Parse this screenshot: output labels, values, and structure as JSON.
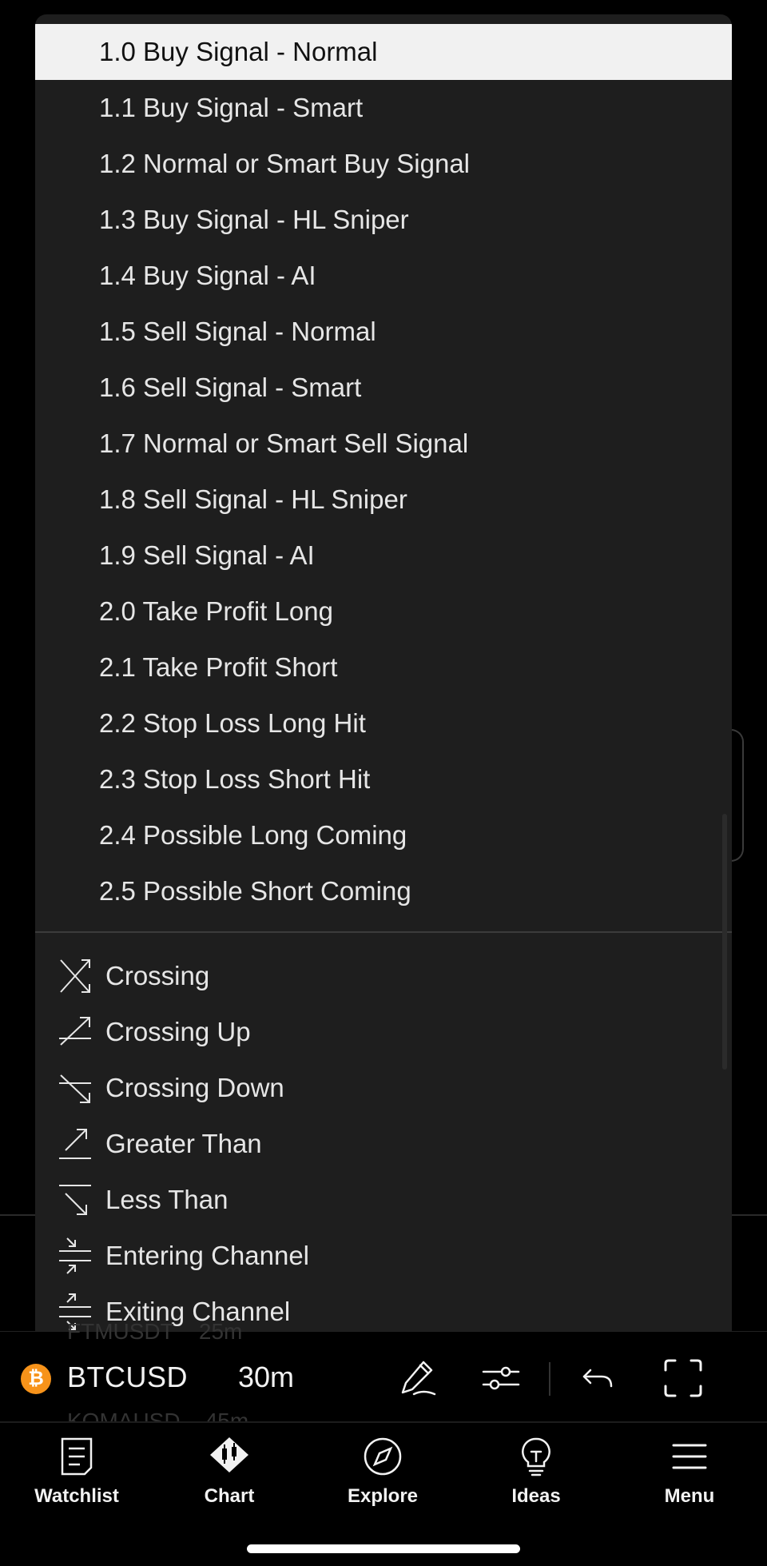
{
  "signals": [
    {
      "label": "1.0 Buy Signal - Normal",
      "selected": true
    },
    {
      "label": "1.1 Buy Signal - Smart"
    },
    {
      "label": "1.2 Normal or Smart Buy Signal"
    },
    {
      "label": "1.3 Buy Signal - HL Sniper"
    },
    {
      "label": "1.4 Buy Signal - AI"
    },
    {
      "label": "1.5 Sell Signal - Normal"
    },
    {
      "label": "1.6 Sell Signal - Smart"
    },
    {
      "label": "1.7 Normal or Smart Sell Signal"
    },
    {
      "label": "1.8 Sell Signal - HL Sniper"
    },
    {
      "label": "1.9 Sell Signal - AI"
    },
    {
      "label": "2.0 Take Profit Long"
    },
    {
      "label": "2.1 Take Profit Short"
    },
    {
      "label": "2.2 Stop Loss Long Hit"
    },
    {
      "label": "2.3 Stop Loss Short Hit"
    },
    {
      "label": "2.4 Possible Long Coming"
    },
    {
      "label": "2.5 Possible Short Coming"
    }
  ],
  "operators": [
    {
      "label": "Crossing",
      "icon": "crossing-icon"
    },
    {
      "label": "Crossing Up",
      "icon": "crossing-up-icon"
    },
    {
      "label": "Crossing Down",
      "icon": "crossing-down-icon"
    },
    {
      "label": "Greater Than",
      "icon": "greater-than-icon"
    },
    {
      "label": "Less Than",
      "icon": "less-than-icon"
    },
    {
      "label": "Entering Channel",
      "icon": "entering-channel-icon"
    },
    {
      "label": "Exiting Channel",
      "icon": "exiting-channel-icon"
    }
  ],
  "background_watchlist": [
    {
      "symbol": "FTMUSDT",
      "interval": "25m"
    },
    {
      "symbol": "KOMAUSD",
      "interval": "45m"
    }
  ],
  "toolbar": {
    "coin_glyph": "₿",
    "symbol": "BTCUSD",
    "interval": "30m"
  },
  "nav": [
    {
      "label": "Watchlist",
      "icon": "watchlist-icon"
    },
    {
      "label": "Chart",
      "icon": "chart-icon"
    },
    {
      "label": "Explore",
      "icon": "explore-icon"
    },
    {
      "label": "Ideas",
      "icon": "ideas-icon"
    },
    {
      "label": "Menu",
      "icon": "menu-icon"
    }
  ],
  "colors": {
    "menu_bg": "#1e1e1e",
    "selected_bg": "#f1f1f1",
    "coin": "#f7931a",
    "text": "#e6e6e6"
  }
}
